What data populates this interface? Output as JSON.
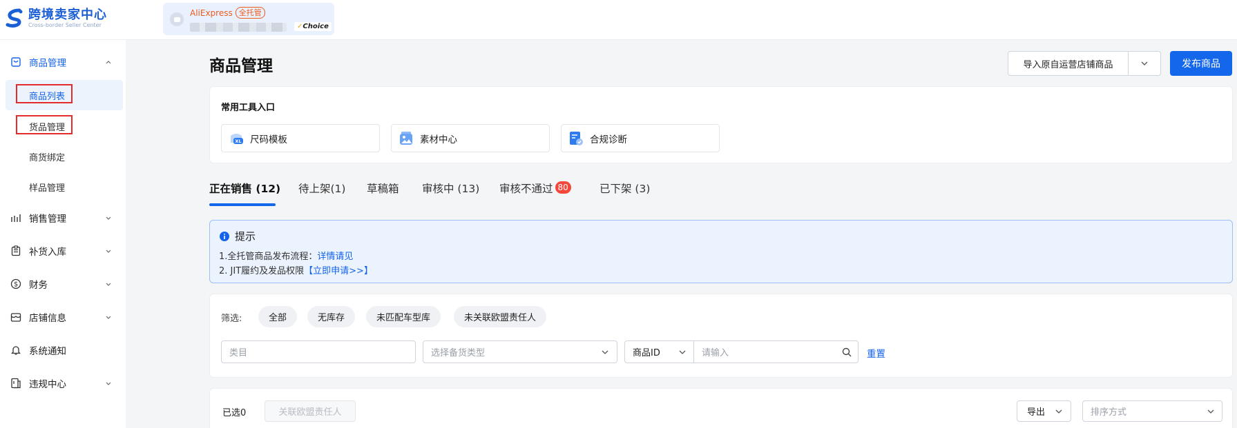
{
  "brand": {
    "name_cn": "跨境卖家中心",
    "name_en": "Cross-border Seller Center"
  },
  "store": {
    "platform": "AliExpress",
    "tag": "全托管",
    "choice_label": "Choice"
  },
  "sidebar": {
    "groups": [
      {
        "label": "商品管理",
        "icon": "box-icon",
        "expanded": true
      },
      {
        "label": "销售管理",
        "icon": "bar-chart-icon",
        "expanded": false
      },
      {
        "label": "补货入库",
        "icon": "clipboard-icon",
        "expanded": false
      },
      {
        "label": "财务",
        "icon": "dollar-icon",
        "expanded": false
      },
      {
        "label": "店铺信息",
        "icon": "store-icon",
        "expanded": false
      },
      {
        "label": "系统通知",
        "icon": "bell-icon",
        "expanded": false
      },
      {
        "label": "违规中心",
        "icon": "document-icon",
        "expanded": false
      }
    ],
    "sub_items": [
      {
        "label": "商品列表",
        "selected": true
      },
      {
        "label": "货品管理",
        "selected": false
      },
      {
        "label": "商货绑定",
        "selected": false
      },
      {
        "label": "样品管理",
        "selected": false
      }
    ]
  },
  "header": {
    "title": "商品管理",
    "import_label": "导入原自运营店铺商品",
    "publish_label": "发布商品"
  },
  "tools": {
    "title": "常用工具入口",
    "items": [
      {
        "label": "尺码模板",
        "icon": "size-template-icon"
      },
      {
        "label": "素材中心",
        "icon": "material-center-icon"
      },
      {
        "label": "合规诊断",
        "icon": "compliance-diagnosis-icon"
      }
    ]
  },
  "tabs": [
    {
      "label": "正在销售 (12)",
      "active": true
    },
    {
      "label": "待上架(1)",
      "active": false
    },
    {
      "label": "草稿箱",
      "active": false
    },
    {
      "label": "审核中 (13)",
      "active": false
    },
    {
      "label": "审核不通过",
      "badge": "80",
      "active": false
    },
    {
      "label": "已下架 (3)",
      "active": false
    }
  ],
  "notice": {
    "title": "提示",
    "line1_text": "1.全托管商品发布流程：",
    "line1_link": "详情请见",
    "line2_text": "2. JIT履约及发品权限",
    "line2_link": "【立即申请>>】"
  },
  "filters": {
    "label": "筛选:",
    "chips": [
      "全部",
      "无库存",
      "未匹配车型库",
      "未关联欧盟责任人"
    ],
    "category_placeholder": "类目",
    "stock_type_placeholder": "选择备货类型",
    "id_select_value": "商品ID",
    "id_input_placeholder": "请输入",
    "reset_label": "重置"
  },
  "list": {
    "selected_label": "已选0",
    "associate_label": "关联欧盟责任人",
    "export_label": "导出",
    "sort_placeholder": "排序方式"
  },
  "colors": {
    "primary": "#1467ea",
    "brand": "#1b5fd6",
    "badge": "#f5463c",
    "highlight": "#e32b2b",
    "aliexpress": "#ec5a1c"
  }
}
